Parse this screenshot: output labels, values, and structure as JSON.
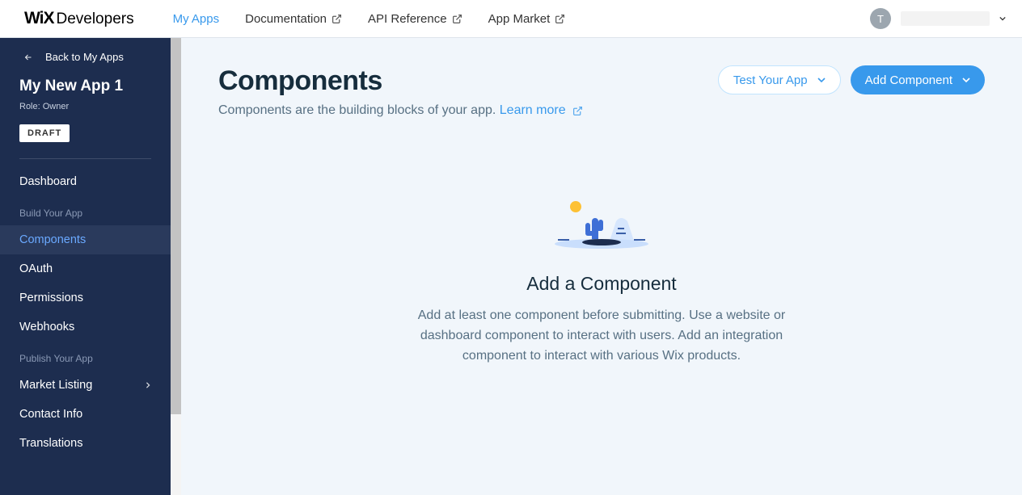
{
  "topnav": {
    "logo_wix": "WiX",
    "logo_dev": "Developers",
    "items": [
      {
        "label": "My Apps",
        "external": false,
        "active": true
      },
      {
        "label": "Documentation",
        "external": true,
        "active": false
      },
      {
        "label": "API Reference",
        "external": true,
        "active": false
      },
      {
        "label": "App Market",
        "external": true,
        "active": false
      }
    ],
    "avatar_letter": "T"
  },
  "sidebar": {
    "back_label": "Back to My Apps",
    "app_name": "My New App 1",
    "role_line": "Role: Owner",
    "badge": "DRAFT",
    "top_item": "Dashboard",
    "section_build_label": "Build Your App",
    "build_items": [
      {
        "label": "Components",
        "active": true
      },
      {
        "label": "OAuth",
        "active": false
      },
      {
        "label": "Permissions",
        "active": false
      },
      {
        "label": "Webhooks",
        "active": false
      }
    ],
    "section_publish_label": "Publish Your App",
    "publish_items": [
      {
        "label": "Market Listing",
        "chevron": true
      },
      {
        "label": "Contact Info",
        "chevron": false
      },
      {
        "label": "Translations",
        "chevron": false
      }
    ]
  },
  "main": {
    "title": "Components",
    "subtitle_text": "Components are the building blocks of your app. ",
    "learn_more": "Learn more",
    "test_button": "Test Your App",
    "add_button": "Add Component",
    "empty_title": "Add a Component",
    "empty_desc": "Add at least one component before submitting. Use a website or dashboard component to interact with users. Add an integration component to interact with various Wix products."
  }
}
